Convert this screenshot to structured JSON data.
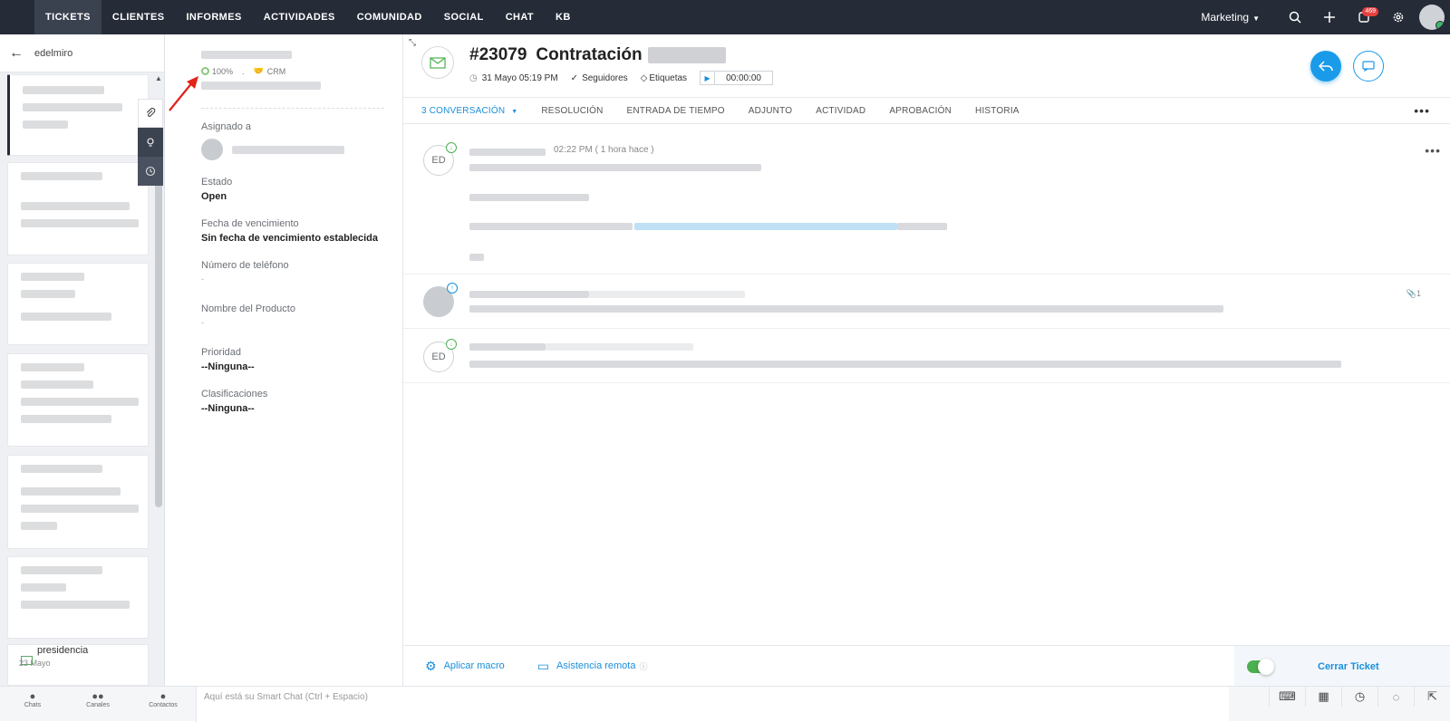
{
  "topnav": {
    "tabs": [
      {
        "label": "TICKETS",
        "active": true
      },
      {
        "label": "CLIENTES"
      },
      {
        "label": "INFORMES"
      },
      {
        "label": "ACTIVIDADES"
      },
      {
        "label": "COMUNIDAD"
      },
      {
        "label": "SOCIAL"
      },
      {
        "label": "CHAT"
      },
      {
        "label": "KB"
      }
    ],
    "department": "Marketing",
    "notification_badge": "469",
    "icons": [
      "search-icon",
      "plus-icon",
      "notification-icon",
      "gear-icon",
      "user-avatar"
    ]
  },
  "leftpane": {
    "filter_label": "edelmiro",
    "last_card": {
      "title": "presidencia",
      "date": "23 Mayo"
    }
  },
  "detail": {
    "progress": "100%",
    "crm_label": "CRM",
    "fields": [
      {
        "label": "Asignado a",
        "value": ""
      },
      {
        "label": "Estado",
        "value": "Open"
      },
      {
        "label": "Fecha de vencimiento",
        "value": "Sin fecha de vencimiento establecida"
      },
      {
        "label": "Número de teléfono",
        "value": "-"
      },
      {
        "label": "Nombre del Producto",
        "value": "-"
      },
      {
        "label": "Prioridad",
        "value": "--Ninguna--"
      },
      {
        "label": "Clasificaciones",
        "value": "--Ninguna--"
      }
    ]
  },
  "ticket": {
    "number": "#23079",
    "title": "Contratación",
    "date": "31 Mayo 05:19 PM",
    "followers_label": "Seguidores",
    "tags_label": "Etiquetas",
    "timer": "00:00:00"
  },
  "subtabs": [
    {
      "label": "3 CONVERSACIÓN",
      "active": true
    },
    {
      "label": "RESOLUCIÓN"
    },
    {
      "label": "ENTRADA DE TIEMPO"
    },
    {
      "label": "ADJUNTO"
    },
    {
      "label": "ACTIVIDAD"
    },
    {
      "label": "APROBACIÓN"
    },
    {
      "label": "HISTORIA"
    }
  ],
  "threads": [
    {
      "initials": "ED",
      "time": "02:22 PM ( 1 hora hace )"
    },
    {
      "initials": "",
      "attachments": "1"
    },
    {
      "initials": "ED"
    }
  ],
  "actionbar": {
    "macro": "Aplicar macro",
    "remote": "Asistencia remota",
    "close": "Cerrar Ticket"
  },
  "footer": {
    "nav": [
      "Chats",
      "Canales",
      "Contactos"
    ],
    "smartchat_placeholder": "Aquí está su Smart Chat (Ctrl + Espacio)"
  },
  "colors": {
    "nav_bg": "#252b37",
    "accent": "#1a9bea",
    "toggle_on": "#4caf50",
    "badge": "#e8403e"
  }
}
